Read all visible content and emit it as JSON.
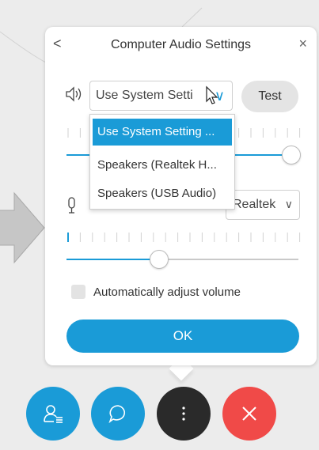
{
  "dialog": {
    "back_label": "<",
    "title": "Computer Audio Settings",
    "close_label": "×"
  },
  "speaker": {
    "icon": "speaker-icon",
    "selected_value": "Use System Setti",
    "test_label": "Test",
    "dropdown_options": [
      "Use System Setting ...",
      "Speakers (Realtek H...",
      "Speakers (USB Audio)"
    ],
    "selected_option_index": 0,
    "volume_fraction": 0.97
  },
  "microphone": {
    "icon": "microphone-icon",
    "selected_value": "Realtek",
    "volume_fraction": 0.4
  },
  "auto_adjust": {
    "label": "Automatically adjust volume",
    "checked": false
  },
  "ok_label": "OK",
  "controls": [
    "participants-icon",
    "chat-icon",
    "more-options-icon",
    "end-call-icon"
  ],
  "colors": {
    "accent": "#1a9bd7",
    "end_call": "#f04a48",
    "more": "#2a2a2a"
  }
}
